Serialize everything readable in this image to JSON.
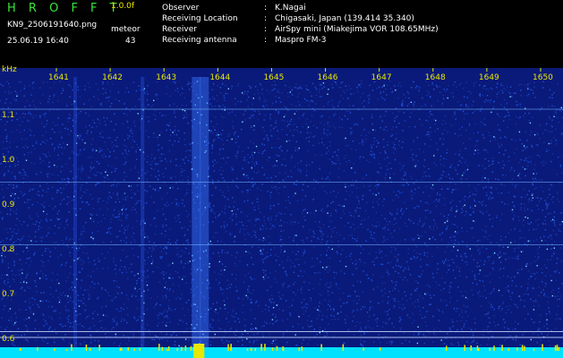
{
  "header": {
    "app_title": "H R O F F T",
    "version": "1.0.0f",
    "filename": "KN9_2506191640.png",
    "meteor_label": "meteor",
    "datetime": "25.06.19 16:40",
    "meteor_count": "43"
  },
  "info": [
    {
      "key": "Observer",
      "value": "K.Nagai"
    },
    {
      "key": "Receiving Location",
      "value": "Chigasaki, Japan (139.414 35.340)"
    },
    {
      "key": "Receiver",
      "value": "AirSpy mini (Miakejima VOR 108.65MHz)"
    },
    {
      "key": "Receiving antenna",
      "value": "Maspro FM-3"
    }
  ],
  "colon": ":",
  "chart_data": {
    "type": "heatmap",
    "yunit": "kHz",
    "x_ticks": [
      "1641",
      "1642",
      "1643",
      "1644",
      "1645",
      "1646",
      "1647",
      "1648",
      "1649",
      "1650"
    ],
    "y_ticks": [
      "1.1",
      "1.0",
      "0.9",
      "0.8",
      "0.7",
      "0.6"
    ],
    "x_range": [
      1640.6,
      1650.4
    ],
    "y_range": [
      0.585,
      1.195
    ],
    "colors": {
      "background": "#000000",
      "noise_base": "#0a1a7a",
      "noise_mid": "#1f4fd8",
      "noise_hot": "#7fd8ff",
      "label": "#e8e800",
      "baseline": "#00e0ff"
    },
    "horizontal_lines_khz": [
      1.115,
      0.952,
      0.812,
      0.618,
      0.605
    ],
    "vertical_bands_min": [
      1643.6,
      1643.75,
      1641.35,
      1642.6
    ]
  }
}
